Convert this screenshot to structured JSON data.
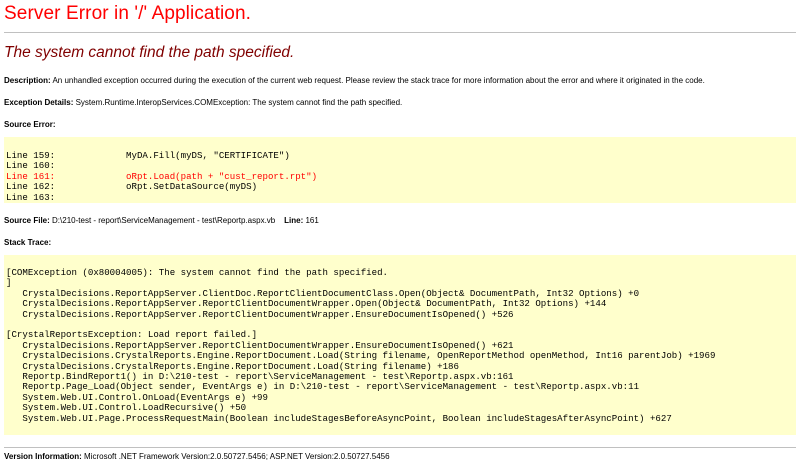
{
  "page": {
    "title": "Server Error in '/' Application.",
    "subtitle": "The system cannot find the path specified."
  },
  "description": {
    "label": "Description:",
    "text": "An unhandled exception occurred during the execution of the current web request. Please review the stack trace for more information about the error and where it originated in the code."
  },
  "exception_details": {
    "label": "Exception Details:",
    "text": "System.Runtime.InteropServices.COMException: The system cannot find the path specified."
  },
  "source_error": {
    "label": "Source Error:",
    "lines": [
      "Line 159:             MyDA.Fill(myDS, \"CERTIFICATE\")",
      "Line 160:",
      "Line 161:             oRpt.Load(path + \"cust_report.rpt\")",
      "Line 162:             oRpt.SetDataSource(myDS)",
      "Line 163:"
    ]
  },
  "source_file": {
    "label": "Source File:",
    "path": "D:\\210-test - report\\ServiceManagement - test\\Reportp.aspx.vb",
    "line_label": "Line:",
    "line_number": "161"
  },
  "stack_trace": {
    "label": "Stack Trace:",
    "lines": [
      "[COMException (0x80004005): The system cannot find the path specified.",
      "]",
      "   CrystalDecisions.ReportAppServer.ClientDoc.ReportClientDocumentClass.Open(Object& DocumentPath, Int32 Options) +0",
      "   CrystalDecisions.ReportAppServer.ReportClientDocumentWrapper.Open(Object& DocumentPath, Int32 Options) +144",
      "   CrystalDecisions.ReportAppServer.ReportClientDocumentWrapper.EnsureDocumentIsOpened() +526",
      "",
      "[CrystalReportsException: Load report failed.]",
      "   CrystalDecisions.ReportAppServer.ReportClientDocumentWrapper.EnsureDocumentIsOpened() +621",
      "   CrystalDecisions.CrystalReports.Engine.ReportDocument.Load(String filename, OpenReportMethod openMethod, Int16 parentJob) +1969",
      "   CrystalDecisions.CrystalReports.Engine.ReportDocument.Load(String filename) +186",
      "   Reportp.BindReport1() in D:\\210-test - report\\ServiceManagement - test\\Reportp.aspx.vb:161",
      "   Reportp.Page_Load(Object sender, EventArgs e) in D:\\210-test - report\\ServiceManagement - test\\Reportp.aspx.vb:11",
      "   System.Web.UI.Control.OnLoad(EventArgs e) +99",
      "   System.Web.UI.Control.LoadRecursive() +50",
      "   System.Web.UI.Page.ProcessRequestMain(Boolean includeStagesBeforeAsyncPoint, Boolean includeStagesAfterAsyncPoint) +627"
    ]
  },
  "version_info": {
    "label": "Version Information:",
    "text": "Microsoft .NET Framework Version:2.0.50727.5456; ASP.NET Version:2.0.50727.5456"
  }
}
